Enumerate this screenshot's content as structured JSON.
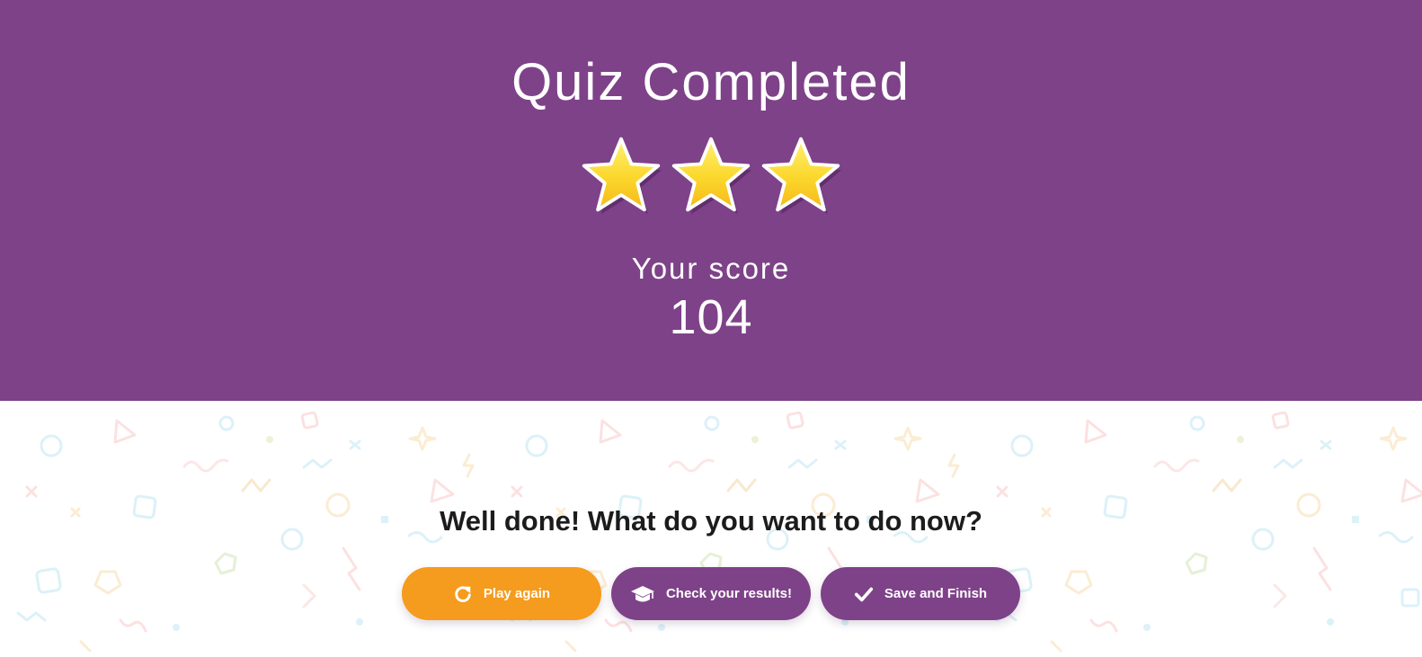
{
  "hero": {
    "title": "Quiz Completed",
    "stars_earned": 3,
    "stars_total": 3,
    "score_label": "Your score",
    "score_value": "104"
  },
  "prompt": {
    "text": "Well done! What do you want to do now?"
  },
  "actions": [
    {
      "label": "Play again",
      "icon": "refresh-icon",
      "color": "#f59b1d"
    },
    {
      "label": "Check your results!",
      "icon": "graduation-cap-icon",
      "color": "#7e4289"
    },
    {
      "label": "Save and Finish",
      "icon": "checkmark-icon",
      "color": "#7e4289"
    }
  ],
  "colors": {
    "brand_purple": "#7e4289",
    "accent_orange": "#f59b1d",
    "star_gold": "#f9d423"
  }
}
